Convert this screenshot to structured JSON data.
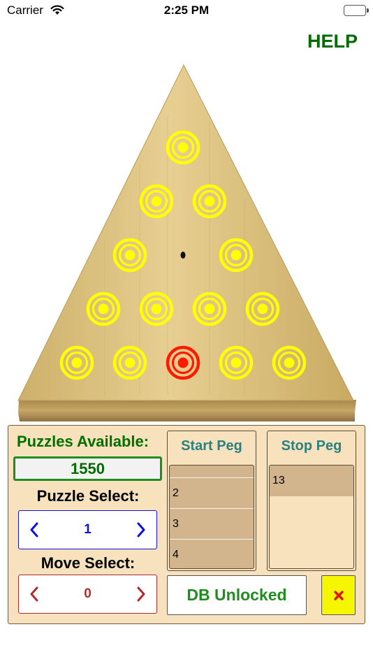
{
  "status_bar": {
    "carrier": "Carrier",
    "time": "2:25 PM",
    "wifi_icon": "wifi-icon",
    "battery_icon": "battery-icon"
  },
  "header": {
    "help_label": "HELP"
  },
  "board": {
    "rows": [
      [
        "peg"
      ],
      [
        "peg",
        "peg"
      ],
      [
        "peg",
        "hole",
        "peg"
      ],
      [
        "peg",
        "peg",
        "peg",
        "peg"
      ],
      [
        "peg",
        "peg",
        "target",
        "peg",
        "peg"
      ]
    ],
    "colors": {
      "peg": "#ffff00",
      "target": "#ff1a00",
      "wood": "#dcc07a"
    }
  },
  "panel": {
    "puzzles_available_label": "Puzzles Available:",
    "puzzles_available_value": "1550",
    "puzzle_select_label": "Puzzle Select:",
    "puzzle_select_value": "1",
    "move_select_label": "Move Select:",
    "move_select_value": "0",
    "start_peg_title": "Start Peg",
    "start_peg_items": [
      "2",
      "3",
      "4"
    ],
    "stop_peg_title": "Stop Peg",
    "stop_peg_items": [
      "13"
    ],
    "db_status_label": "DB Unlocked",
    "clear_icon": "close-x-icon",
    "colors": {
      "panel_bg": "#f7e2bd",
      "green": "#1f8d1f",
      "blue": "#1010dd",
      "red": "#b02b2b",
      "teal": "#2b8080",
      "yellow": "#f6f600"
    }
  }
}
